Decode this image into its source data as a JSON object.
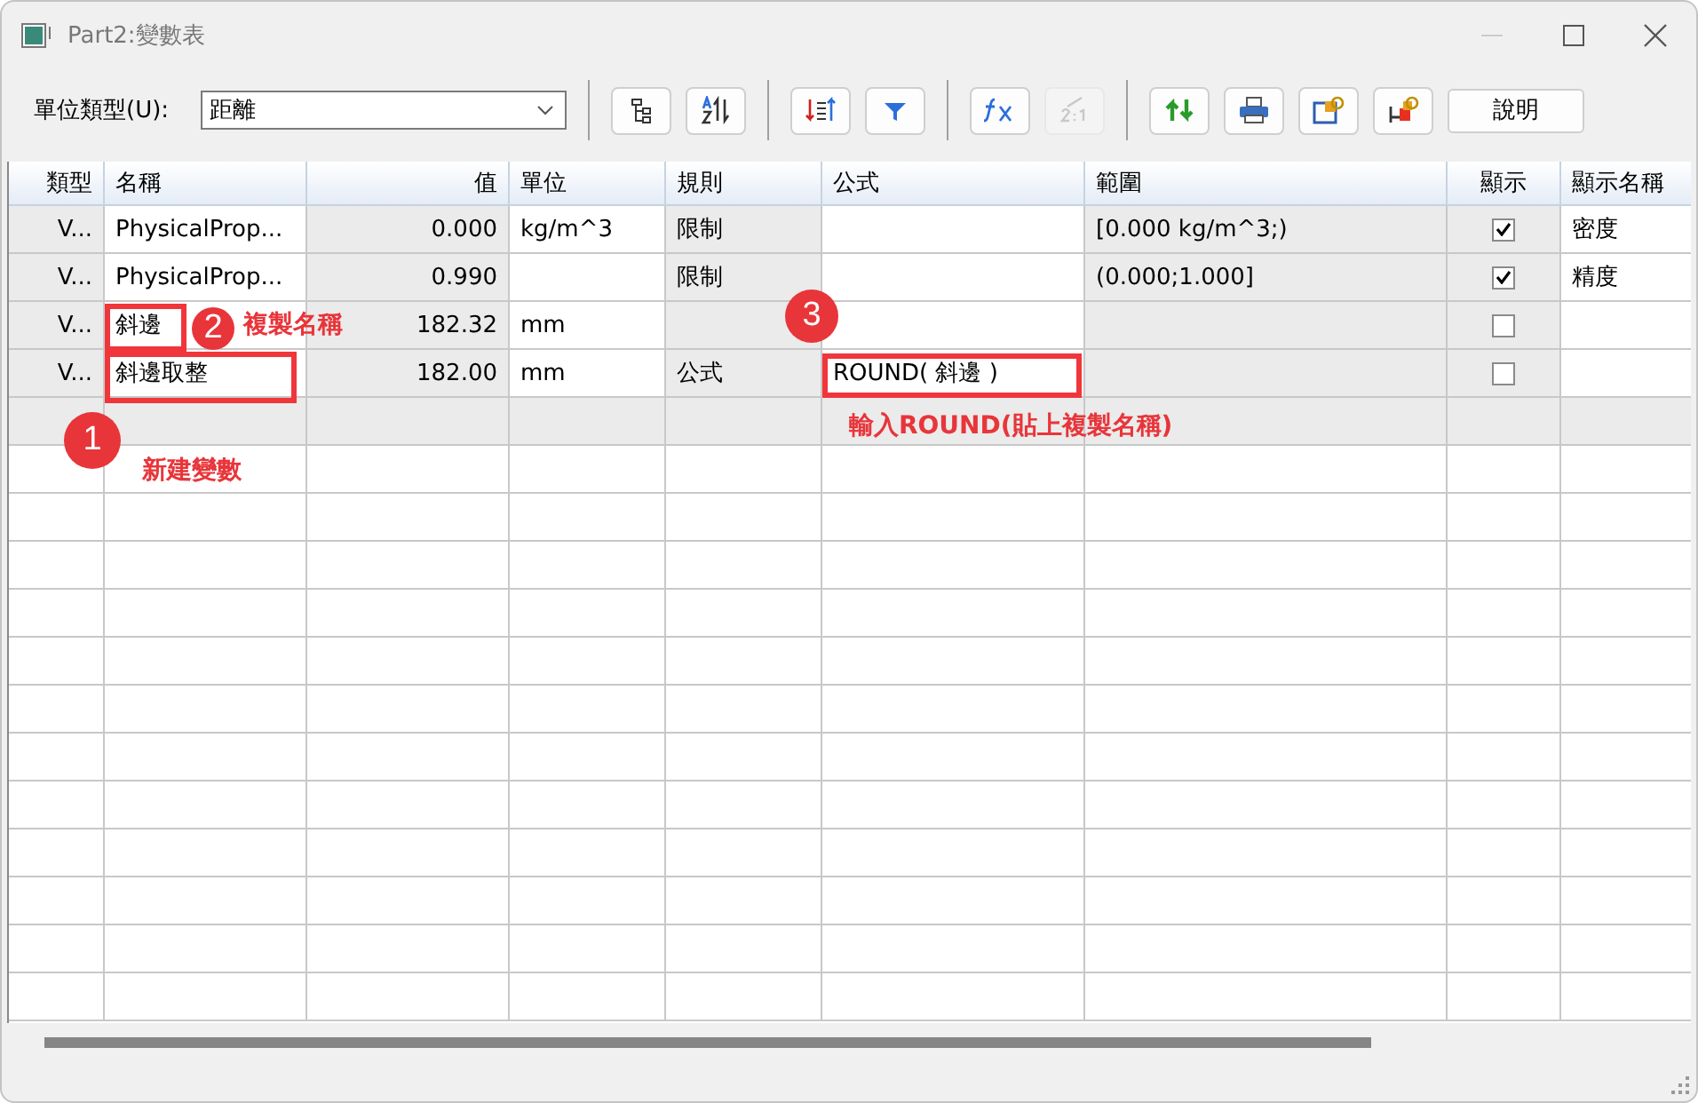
{
  "window": {
    "title": "Part2:變數表"
  },
  "toolbar": {
    "unit_type_label": "單位類型(U):",
    "unit_type_value": "距離",
    "buttons": [
      {
        "kind": "tree",
        "disabled": false
      },
      {
        "kind": "sort-az",
        "disabled": false
      },
      {
        "kind": "sort-list",
        "disabled": false
      },
      {
        "kind": "filter",
        "disabled": false
      },
      {
        "kind": "function",
        "disabled": false
      },
      {
        "kind": "ratio",
        "disabled": true
      },
      {
        "kind": "refresh",
        "disabled": false
      },
      {
        "kind": "print",
        "disabled": false
      },
      {
        "kind": "export",
        "disabled": false
      },
      {
        "kind": "import",
        "disabled": false
      }
    ],
    "help_button": "說明"
  },
  "table": {
    "columns": [
      "類型",
      "名稱",
      "值",
      "單位",
      "規則",
      "公式",
      "範圍",
      "顯示",
      "顯示名稱"
    ],
    "rows": [
      {
        "type": "V...",
        "name": "PhysicalProp...",
        "value": "0.000",
        "unit": "kg/m^3",
        "rule": "限制",
        "formula": "",
        "range": "[0.000 kg/m^3;)",
        "show": true,
        "display_name": "密度"
      },
      {
        "type": "V...",
        "name": "PhysicalProp...",
        "value": "0.990",
        "unit": "",
        "rule": "限制",
        "formula": "",
        "range": "(0.000;1.000]",
        "show": true,
        "display_name": "精度"
      },
      {
        "type": "V...",
        "name": "斜邊",
        "value": "182.32",
        "unit": "mm",
        "rule": "",
        "formula": "",
        "range": "",
        "show": false,
        "display_name": ""
      },
      {
        "type": "V...",
        "name": "斜邊取整",
        "value": "182.00",
        "unit": "mm",
        "rule": "公式",
        "formula": "ROUND( 斜邊 )",
        "range": "",
        "show": false,
        "display_name": ""
      }
    ]
  },
  "annotations": [
    {
      "number": "1",
      "label": "新建變數"
    },
    {
      "number": "2",
      "label": "複製名稱"
    },
    {
      "number": "3",
      "label": "輸入ROUND(貼上複製名稱)"
    }
  ]
}
